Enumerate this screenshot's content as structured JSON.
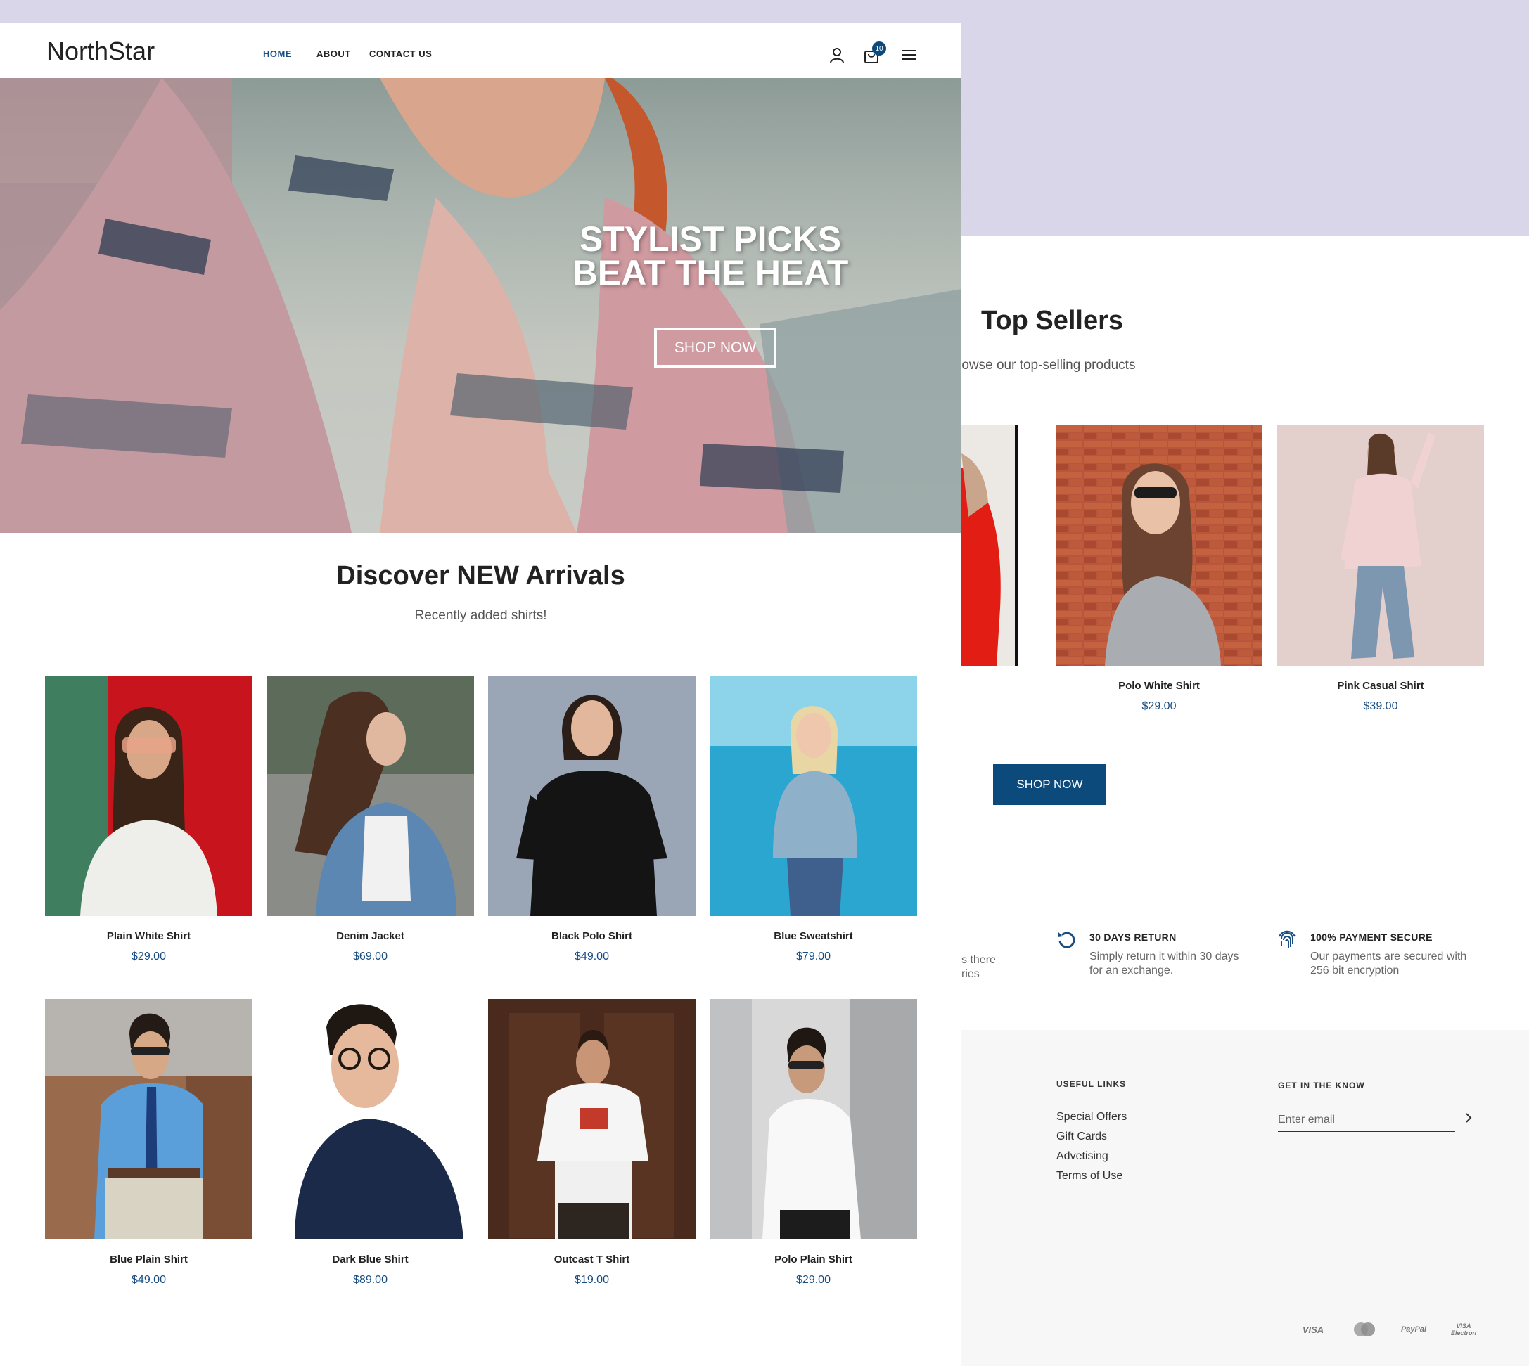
{
  "brand": {
    "name": "NorthStar",
    "accent": "#0c4a7c",
    "price_color": "#184d82",
    "backdrop": "#d9d6ea"
  },
  "nav": {
    "links": [
      {
        "label": "HOME",
        "active": true
      },
      {
        "label": "ABOUT",
        "active": false
      },
      {
        "label": "CONTACT US",
        "active": false
      }
    ],
    "icons": [
      "user-icon",
      "cart-icon",
      "menu-icon"
    ],
    "cart_count": "10"
  },
  "hero": {
    "title": "STYLIST PICKS BEAT THE HEAT",
    "button": "SHOP NOW"
  },
  "arrivals": {
    "title": "Discover NEW Arrivals",
    "subtitle": "Recently added shirts!",
    "products": [
      {
        "name": "Plain White Shirt",
        "price": "$29.00"
      },
      {
        "name": "Denim Jacket",
        "price": "$69.00"
      },
      {
        "name": "Black Polo Shirt",
        "price": "$49.00"
      },
      {
        "name": "Blue Sweatshirt",
        "price": "$79.00"
      },
      {
        "name": "Blue Plain Shirt",
        "price": "$49.00"
      },
      {
        "name": "Dark Blue Shirt",
        "price": "$89.00"
      },
      {
        "name": "Outcast T Shirt",
        "price": "$19.00"
      },
      {
        "name": "Polo Plain Shirt",
        "price": "$29.00"
      }
    ]
  },
  "top_sellers": {
    "title": "Top Sellers",
    "subtitle": "rowse our top-selling products",
    "products": [
      {
        "name": "Polo White Shirt",
        "price": "$29.00"
      },
      {
        "name": "Pink Casual Shirt",
        "price": "$39.00"
      }
    ],
    "button": "SHOP NOW"
  },
  "features": {
    "partial": [
      "s there",
      "ries"
    ],
    "items": [
      {
        "title": "30 DAYS RETURN",
        "desc": "Simply return it within 30 days for an exchange.",
        "icon": "return-icon"
      },
      {
        "title": "100% PAYMENT SECURE",
        "desc": "Our payments are secured with 256 bit encryption",
        "icon": "fingerprint-icon"
      }
    ]
  },
  "footer": {
    "useful_links_title": "USEFUL LINKS",
    "links": [
      "Special Offers",
      "Gift Cards",
      "Advetising",
      "Terms of Use"
    ],
    "newsletter_title": "GET IN THE KNOW",
    "email_placeholder": "Enter email",
    "payments": [
      "VISA",
      "MasterCard",
      "PayPal",
      "VISA Electron"
    ]
  }
}
